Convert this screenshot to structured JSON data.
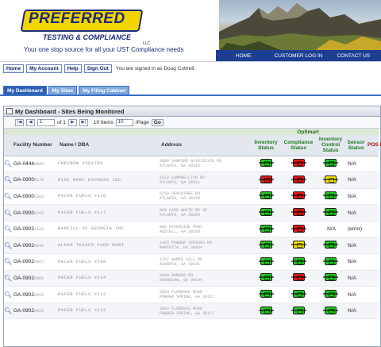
{
  "header": {
    "logo_main": "PREFERRED",
    "logo_sub": "TESTING & COMPLIANCE",
    "logo_llc": "LLC",
    "tagline": "Your one stop source for all your UST Compliance needs",
    "topnav": [
      "HOME",
      "CUSTOMER LOG IN",
      "CONTACT US"
    ]
  },
  "navbar": {
    "buttons": [
      "Home",
      "My Account",
      "Help",
      "Sign Out"
    ],
    "signed_in_text": "You are signed in as Doug Cottrell."
  },
  "tabs": [
    "My Dashboard",
    "My Sites",
    "My Filing Cabinet"
  ],
  "panel": {
    "title": "My Dashboard - Sites Being Monitored",
    "pager": {
      "page_value": "1",
      "of_text": "of 1",
      "items_text": "10 Items",
      "page_size_value": "10",
      "per_page_text": "/Page",
      "go_label": "Go"
    }
  },
  "table": {
    "group_header": "OpSmart",
    "columns": [
      "Facility Number",
      "Name / DBA",
      "Address",
      "Inventory Status",
      "Compliance Status",
      "Inventory Control Status",
      "Sensor Status",
      "POS Data"
    ],
    "rows": [
      {
        "fid": "GA-0444",
        "fid_blur": "0000",
        "name": "CHEVRON #301790",
        "addr1": "3000 SANFORD BLVD/DIXIE PK",
        "addr2": "ATLANTA, GA 30315",
        "inv": "green",
        "comp": "red",
        "ictl": "green",
        "sensor": "N/A"
      },
      {
        "fid": "GA-0900",
        "fid_blur": "0176",
        "name": "MINI MART EXPRESS INC",
        "addr1": "1972 CAMPBELLTON RD",
        "addr2": "ATLANTA, GA 30311",
        "inv": "red",
        "comp": "red",
        "ictl": "yellow",
        "sensor": "N/A"
      },
      {
        "fid": "GA-0900",
        "fid_blur": "0303",
        "name": "PACER FUELS #116",
        "addr1": "6150 PEACHTREE RD",
        "addr2": "ATLANTA, GA 30328",
        "inv": "green",
        "comp": "red",
        "ictl": "green",
        "sensor": "N/A"
      },
      {
        "fid": "GA-0900",
        "fid_blur": "0319",
        "name": "PACER FUELS #117",
        "addr1": "800 CASE WHITE RD SE",
        "addr2": "ATLANTA, GA 30354",
        "inv": "green",
        "comp": "red",
        "ictl": "green",
        "sensor": "N/A"
      },
      {
        "fid": "GA-0902",
        "fid_blur": "1128",
        "name": "BANFILL OF GEORGIA INC",
        "addr1": "985 RIVERSIDE PKWY",
        "addr2": "AUSTELL, GA 30168",
        "inv": "green",
        "comp": "red",
        "ictl": "",
        "sensor": "(error)"
      },
      {
        "fid": "GA-0902",
        "fid_blur": "0045",
        "name": "ALPHA TEXACO FOOD MART",
        "addr1": "1425 POWDER SPRINGS RD",
        "addr2": "MARIETTA, GA 30064",
        "inv": "green",
        "comp": "yellow",
        "ictl": "green",
        "sensor": "N/A"
      },
      {
        "fid": "GA-0902",
        "fid_blur": "0067",
        "name": "PACER FUELS #108",
        "addr1": "1757 NAMES HILL RD",
        "addr2": "ACWORTH, GA 30101",
        "inv": "green",
        "comp": "green",
        "ictl": "green",
        "sensor": "N/A"
      },
      {
        "fid": "GA-0902",
        "fid_blur": "0081",
        "name": "PACER FUELS #114",
        "addr1": "3000 BUBBER RD",
        "addr2": "KENNESAW, GA 30144",
        "inv": "green",
        "comp": "red",
        "ictl": "green",
        "sensor": "N/A"
      },
      {
        "fid": "GA-0902",
        "fid_blur": "0094",
        "name": "PACER FUELS #112",
        "addr1": "3063 FLORENCE ROAD",
        "addr2": "POWDER SPRING, GA 30127",
        "inv": "green",
        "comp": "green",
        "ictl": "green",
        "sensor": "N/A"
      },
      {
        "fid": "GA-0902",
        "fid_blur": "0095",
        "name": "PACER FUELS #122",
        "addr1": "3063 FLORENCE ROAD",
        "addr2": "POWDER SPRING, GA 30127",
        "inv": "green",
        "comp": "green",
        "ictl": "green",
        "sensor": "N/A"
      }
    ]
  },
  "colors": {
    "green": "#22c422",
    "red": "#e01818",
    "yellow": "#f2e200",
    "brand_blue": "#1c3f94",
    "brand_yellow": "#f2d500"
  }
}
